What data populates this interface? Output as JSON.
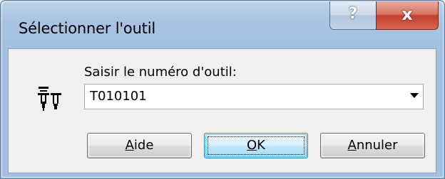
{
  "window": {
    "title": "Sélectionner l'outil",
    "help_glyph": "?",
    "close_glyph": "x"
  },
  "form": {
    "label": "Saisir le numéro d'outil:",
    "tool_number_value": "T010101"
  },
  "buttons": {
    "help": {
      "mnemonic": "A",
      "rest": "ide"
    },
    "ok": {
      "mnemonic": "O",
      "rest": "K"
    },
    "cancel": {
      "mnemonic": "A",
      "rest": "nnuler"
    }
  },
  "icons": {
    "tool": "tool-holder-icon",
    "dropdown": "dropdown-arrow-icon",
    "help": "help-icon",
    "close": "close-icon"
  },
  "colors": {
    "title_bar": "#a9c4e2",
    "client_bg": "#f0f0f0",
    "close_button": "#c3412d",
    "default_button_border": "#3c7fb1"
  }
}
